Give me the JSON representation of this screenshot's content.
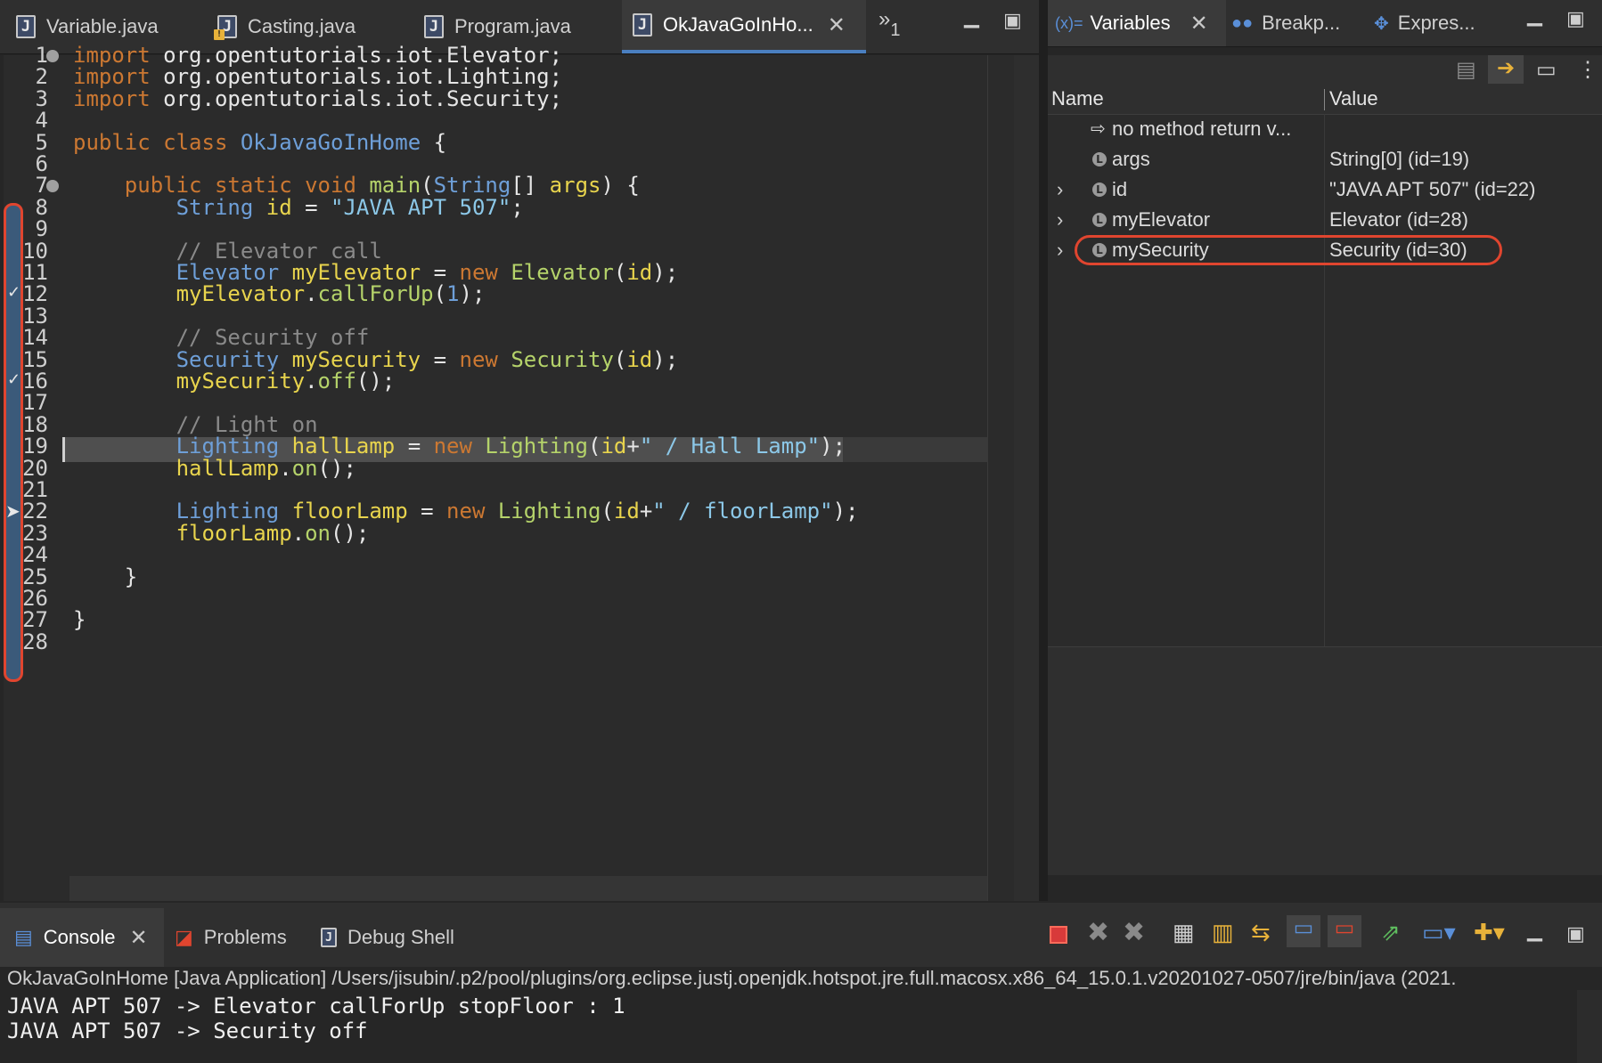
{
  "editor_tabs": [
    {
      "label": "Variable.java"
    },
    {
      "label": "Casting.java"
    },
    {
      "label": "Program.java"
    },
    {
      "label": "OkJavaGoInHo..."
    }
  ],
  "editor_overflow": {
    "label": "»",
    "count": "1"
  },
  "code_lines": [
    {
      "n": "1",
      "text": "import org.opentutorials.iot.Elevator;"
    },
    {
      "n": "2",
      "text": "import org.opentutorials.iot.Lighting;"
    },
    {
      "n": "3",
      "text": "import org.opentutorials.iot.Security;"
    },
    {
      "n": "4",
      "text": ""
    },
    {
      "n": "5",
      "text": "public class OkJavaGoInHome {"
    },
    {
      "n": "6",
      "text": ""
    },
    {
      "n": "7",
      "text": "    public static void main(String[] args) {"
    },
    {
      "n": "8",
      "text": "        String id = \"JAVA APT 507\";"
    },
    {
      "n": "9",
      "text": ""
    },
    {
      "n": "10",
      "text": "        // Elevator call"
    },
    {
      "n": "11",
      "text": "        Elevator myElevator = new Elevator(id);"
    },
    {
      "n": "12",
      "text": "        myElevator.callForUp(1);"
    },
    {
      "n": "13",
      "text": ""
    },
    {
      "n": "14",
      "text": "        // Security off"
    },
    {
      "n": "15",
      "text": "        Security mySecurity = new Security(id);"
    },
    {
      "n": "16",
      "text": "        mySecurity.off();"
    },
    {
      "n": "17",
      "text": ""
    },
    {
      "n": "18",
      "text": "        // Light on"
    },
    {
      "n": "19",
      "text": "        Lighting hallLamp = new Lighting(id+\" / Hall Lamp\");"
    },
    {
      "n": "20",
      "text": "        hallLamp.on();"
    },
    {
      "n": "21",
      "text": ""
    },
    {
      "n": "22",
      "text": "        Lighting floorLamp = new Lighting(id+\" / floorLamp\");"
    },
    {
      "n": "23",
      "text": "        floorLamp.on();"
    },
    {
      "n": "24",
      "text": ""
    },
    {
      "n": "25",
      "text": "    }"
    },
    {
      "n": "26",
      "text": ""
    },
    {
      "n": "27",
      "text": "}"
    },
    {
      "n": "28",
      "text": ""
    }
  ],
  "view_tabs": [
    {
      "label": "Variables",
      "prefix": "(x)="
    },
    {
      "label": "Breakp..."
    },
    {
      "label": "Expres..."
    }
  ],
  "variables": {
    "columns": [
      "Name",
      "Value"
    ],
    "rows": [
      {
        "name": "no method return v...",
        "value": "",
        "expandable": false,
        "icon": "return-arrow-icon"
      },
      {
        "name": "args",
        "value": "String[0]  (id=19)",
        "expandable": false,
        "icon": "local-variable-icon"
      },
      {
        "name": "id",
        "value": "\"JAVA APT 507\" (id=22)",
        "expandable": true,
        "icon": "local-variable-icon"
      },
      {
        "name": "myElevator",
        "value": "Elevator  (id=28)",
        "expandable": true,
        "icon": "local-variable-icon"
      },
      {
        "name": "mySecurity",
        "value": "Security  (id=30)",
        "expandable": true,
        "icon": "local-variable-icon"
      }
    ]
  },
  "bottom_tabs": [
    {
      "label": "Console"
    },
    {
      "label": "Problems"
    },
    {
      "label": "Debug Shell"
    }
  ],
  "console": {
    "header": "OkJavaGoInHome [Java Application] /Users/jisubin/.p2/pool/plugins/org.eclipse.justj.openjdk.hotspot.jre.full.macosx.x86_64_15.0.1.v20201027-0507/jre/bin/java  (2021.",
    "lines": [
      "JAVA APT 507 -> Elevator callForUp stopFloor : 1",
      "JAVA APT 507 -> Security off"
    ]
  },
  "colors": {
    "highlight": "#e0452f",
    "keyword": "#cc7832",
    "type": "#6e9fd8",
    "variable": "#e8d44d",
    "method": "#b5d36a",
    "string": "#8cc8e8",
    "comment": "#8a8a8a",
    "terminate": "#d83a3a"
  }
}
